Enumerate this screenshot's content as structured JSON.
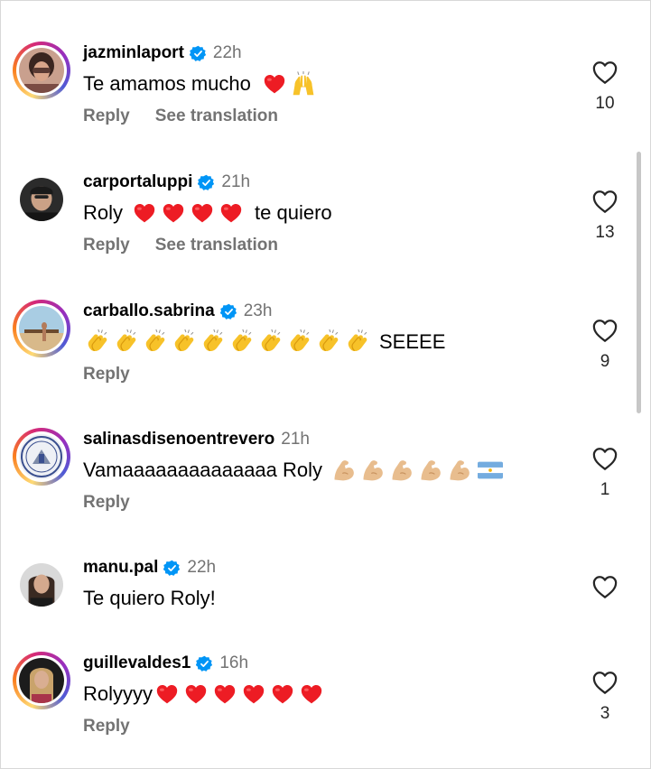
{
  "actions": {
    "reply_label": "Reply",
    "translate_label": "See translation"
  },
  "comments": [
    {
      "username": "jazminlaport",
      "time": "22h",
      "verified": true,
      "story_ring": true,
      "text": "Te amamos mucho",
      "emojis": [
        "red-heart",
        "raising-hands"
      ],
      "likes": "10",
      "show_reply": true,
      "show_translation": true
    },
    {
      "username": "carportaluppi",
      "time": "21h",
      "verified": true,
      "story_ring": false,
      "text": "Roly",
      "emojis": [
        "red-heart",
        "red-heart",
        "red-heart",
        "red-heart"
      ],
      "text_after": "te quiero",
      "likes": "13",
      "show_reply": true,
      "show_translation": true
    },
    {
      "username": "carballo.sabrina",
      "time": "23h",
      "verified": true,
      "story_ring": true,
      "text": "SEEEE",
      "emojis": [
        "clapping-hands",
        "clapping-hands",
        "clapping-hands",
        "clapping-hands",
        "clapping-hands",
        "clapping-hands",
        "clapping-hands",
        "clapping-hands",
        "clapping-hands",
        "clapping-hands"
      ],
      "likes": "9",
      "show_reply": true,
      "show_translation": false
    },
    {
      "username": "salinasdisenoentrevero",
      "time": "21h",
      "verified": false,
      "story_ring": true,
      "text": "Vamaaaaaaaaaaaaaa Roly",
      "emojis": [
        "flexed-biceps",
        "flexed-biceps",
        "flexed-biceps",
        "flexed-biceps",
        "flexed-biceps",
        "argentina-flag"
      ],
      "likes": "1",
      "show_reply": true,
      "show_translation": false
    },
    {
      "username": "manu.pal",
      "time": "22h",
      "verified": true,
      "story_ring": false,
      "text": "Te quiero Roly!",
      "emojis": [],
      "likes": "",
      "show_reply": false,
      "show_translation": false
    },
    {
      "username": "guillevaldes1",
      "time": "16h",
      "verified": true,
      "story_ring": true,
      "text": "Rolyyyy",
      "emojis": [
        "red-heart",
        "red-heart",
        "red-heart",
        "red-heart",
        "red-heart",
        "red-heart"
      ],
      "likes": "3",
      "show_reply": true,
      "show_translation": false
    }
  ],
  "colors": {
    "verified_blue": "#0095f6",
    "secondary_text": "#737373",
    "heart_red": "#ed1c24"
  }
}
